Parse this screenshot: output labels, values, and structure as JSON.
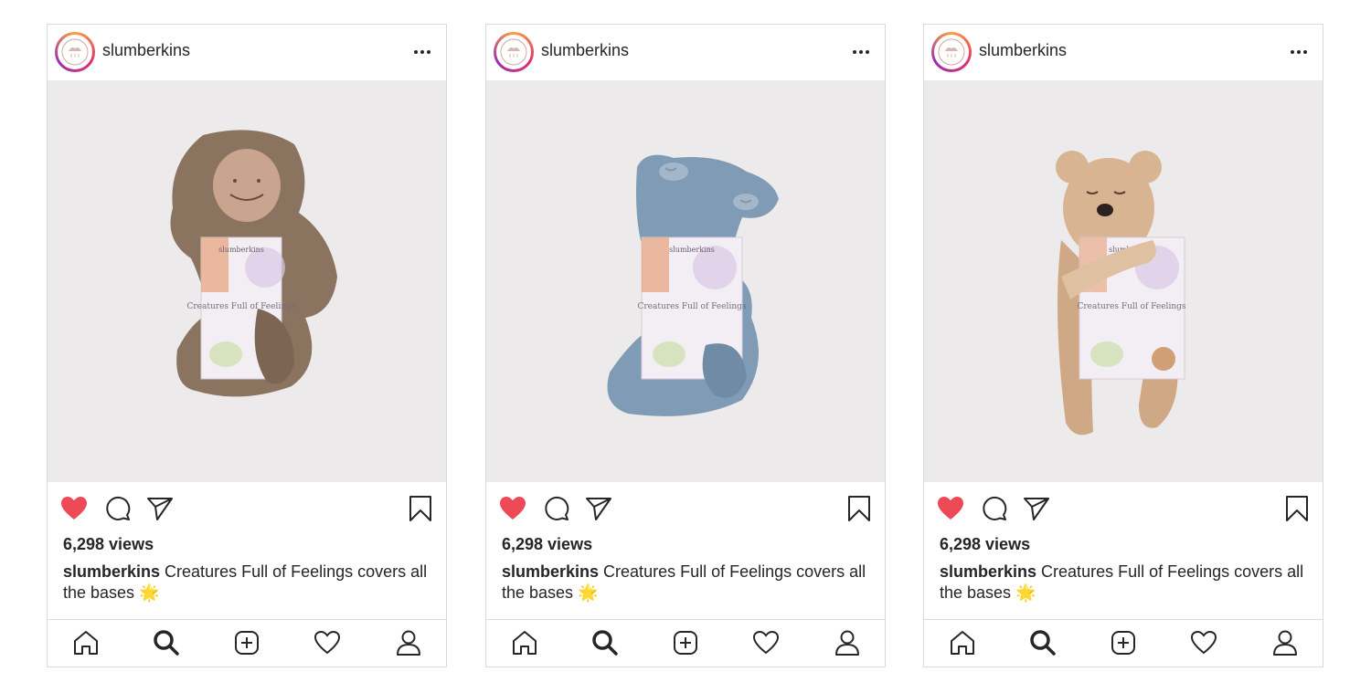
{
  "posts": [
    {
      "username": "slumberkins",
      "views": "6,298 views",
      "caption_user": "slumberkins",
      "caption_text": "Creatures Full of Feelings covers all the bases 🌟",
      "liked": true,
      "photo": {
        "plush_color": "#8a735f",
        "plush_dark": "#6e5a49",
        "face_color": "#c9a48f",
        "book_title": "Creatures Full of Feelings",
        "book_brand": "slumberkins"
      }
    },
    {
      "username": "slumberkins",
      "views": "6,298 views",
      "caption_user": "slumberkins",
      "caption_text": "Creatures Full of Feelings covers all the bases 🌟",
      "liked": true,
      "photo": {
        "plush_color": "#7f9bb5",
        "plush_dark": "#5f7c97",
        "face_color": "#8aa5bd",
        "book_title": "Creatures Full of Feelings",
        "book_brand": "slumberkins"
      }
    },
    {
      "username": "slumberkins",
      "views": "6,298 views",
      "caption_user": "slumberkins",
      "caption_text": "Creatures Full of Feelings covers all the bases 🌟",
      "liked": true,
      "photo": {
        "plush_color": "#d8b493",
        "plush_dark": "#b89372",
        "face_color": "#dbb896",
        "book_title": "Creatures Full of Feelings",
        "book_brand": "slumberkins"
      }
    }
  ],
  "icons": {
    "more": "more-horizontal-icon",
    "like": "heart-filled-icon",
    "comment": "comment-icon",
    "share": "send-icon",
    "save": "bookmark-icon",
    "nav": [
      "home-icon",
      "search-icon",
      "new-post-icon",
      "activity-heart-icon",
      "profile-icon"
    ]
  },
  "colors": {
    "like": "#ed4956",
    "text": "#262626",
    "border": "#dbdbdb"
  }
}
